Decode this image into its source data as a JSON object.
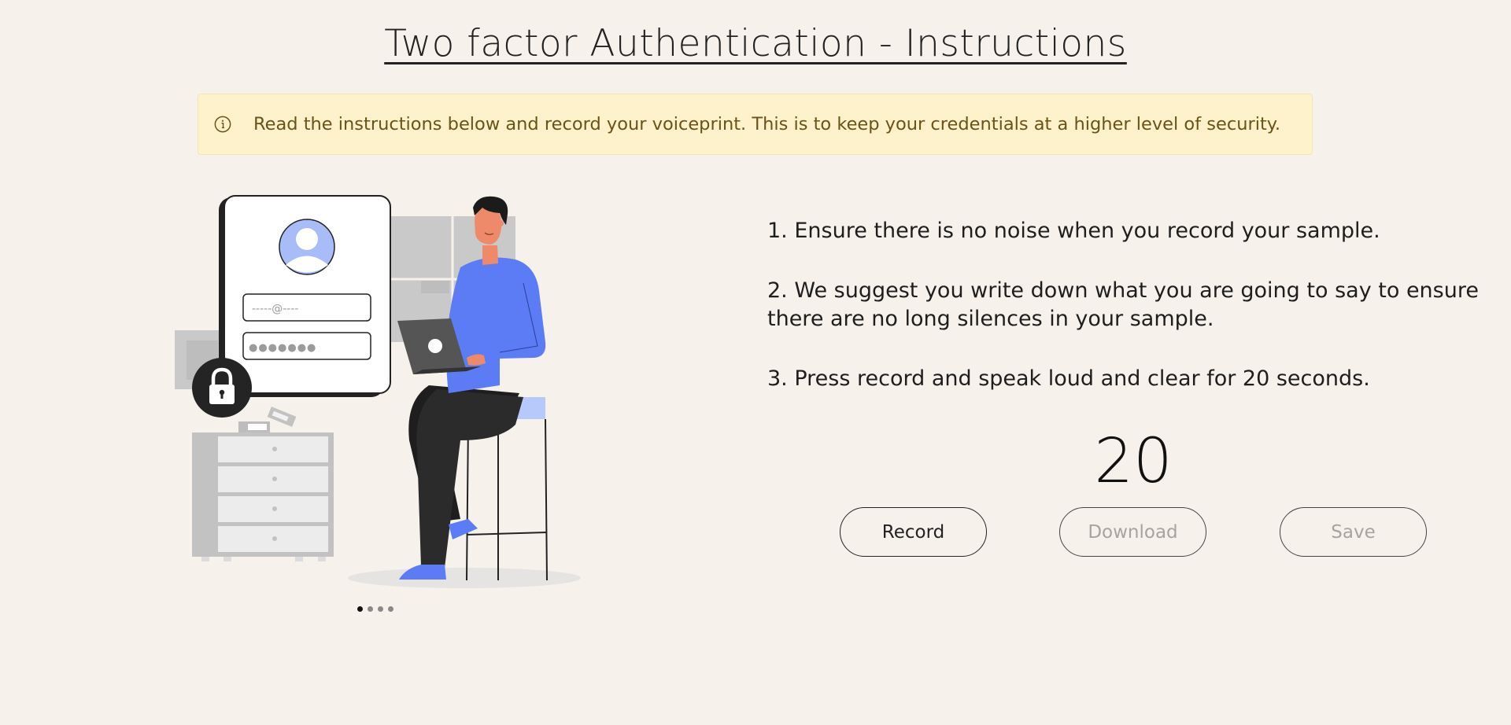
{
  "page": {
    "title": "Two factor Authentication - Instructions"
  },
  "alert": {
    "icon": "info-circle-icon",
    "text": "Read the instructions below and record your voiceprint. This is to keep your credentials at a higher level of security."
  },
  "illustration": {
    "email_placeholder": "-----@----",
    "password_dots": "●●●●●●●",
    "lock_icon": "lock-icon",
    "carousel_slide_count": 4,
    "carousel_active_index": 0
  },
  "instructions": [
    "1. Ensure there is no noise when you record your sample.",
    "2. We suggest you write down what you are going to say to ensure there are no long silences in your sample.",
    "3. Press record and speak loud and clear for 20 seconds."
  ],
  "countdown": "20",
  "buttons": {
    "record": "Record",
    "download": "Download",
    "save": "Save"
  },
  "colors": {
    "background": "#f6f1eb",
    "alert_bg": "#fdf2cc",
    "alert_text": "#6b5317",
    "accent_blue": "#5b7cf5",
    "disabled_text": "#a8a39e"
  }
}
